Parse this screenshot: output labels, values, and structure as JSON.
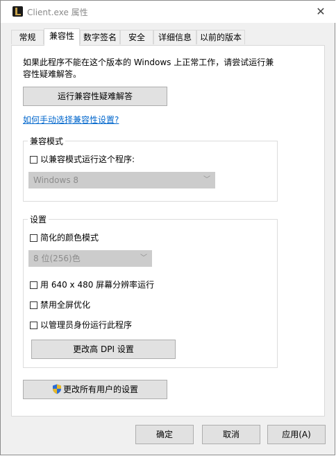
{
  "window": {
    "title": "Client.exe 属性",
    "close_glyph": "✕"
  },
  "tabs": [
    {
      "label": "常规"
    },
    {
      "label": "兼容性"
    },
    {
      "label": "数字签名"
    },
    {
      "label": "安全"
    },
    {
      "label": "详细信息"
    },
    {
      "label": "以前的版本"
    }
  ],
  "active_tab": "兼容性",
  "intro": {
    "text": "如果此程序不能在这个版本的 Windows 上正常工作，请尝试运行兼容性疑难解答。"
  },
  "troubleshooter_button": "运行兼容性疑难解答",
  "manual_link": "如何手动选择兼容性设置?",
  "compat_mode": {
    "title": "兼容模式",
    "checkbox_label": "以兼容模式运行这个程序:",
    "selected_os": "Windows 8"
  },
  "settings": {
    "title": "设置",
    "reduced_color_label": "简化的颜色模式",
    "color_mode_value": "8 位(256)色",
    "resolution_label": "用 640 x 480 屏幕分辨率运行",
    "fullscreen_opt_label": "禁用全屏优化",
    "admin_label": "以管理员身份运行此程序",
    "dpi_button": "更改高 DPI 设置"
  },
  "all_users_button": "更改所有用户的设置",
  "footer": {
    "ok": "确定",
    "cancel": "取消",
    "apply": "应用(A)"
  },
  "colors": {
    "link": "#0066cc",
    "button_bg": "#e1e1e1",
    "disabled_select": "#cccccc"
  },
  "icons": {
    "app": "league-app-icon",
    "shield": "uac-shield-icon"
  }
}
